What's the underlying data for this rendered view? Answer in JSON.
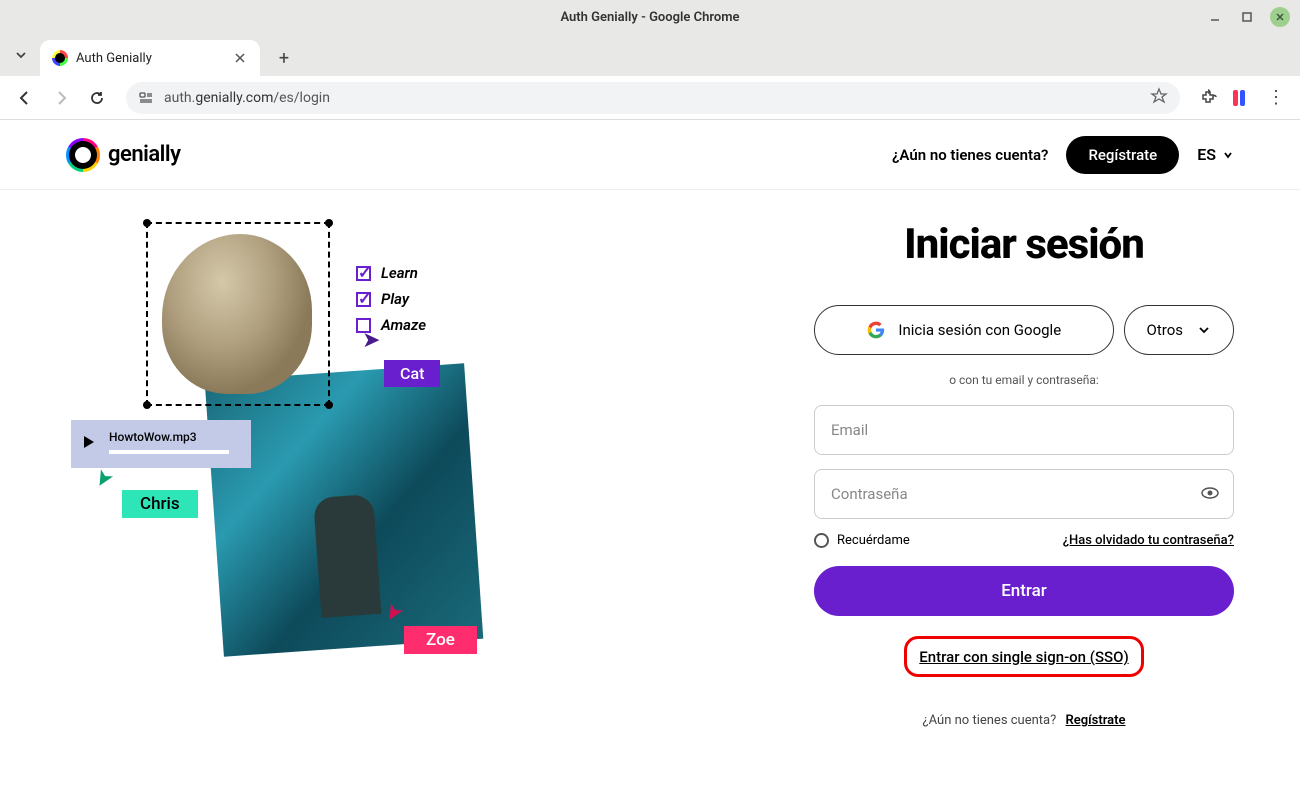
{
  "window": {
    "title": "Auth Genially - Google Chrome"
  },
  "tab": {
    "title": "Auth Genially"
  },
  "url": {
    "prefix": "auth.",
    "domain": "genially.com",
    "path": "/es/login"
  },
  "header": {
    "noaccount": "¿Aún no tienes cuenta?",
    "register": "Regístrate",
    "lang": "ES",
    "brand": "genially"
  },
  "illustration": {
    "todo": {
      "learn": "Learn",
      "play": "Play",
      "amaze": "Amaze"
    },
    "cat_tag": "Cat",
    "audio": "HowtoWow.mp3",
    "chris": "Chris",
    "zoe": "Zoe"
  },
  "form": {
    "title": "Iniciar sesión",
    "google": "Inicia sesión con Google",
    "others": "Otros",
    "divider": "o con tu email y contraseña:",
    "email_ph": "Email",
    "password_ph": "Contraseña",
    "remember": "Recuérdame",
    "forgot": "¿Has olvidado tu contraseña?",
    "enter": "Entrar",
    "sso": "Entrar con single sign-on (SSO)",
    "footer_q": "¿Aún no tienes cuenta?",
    "footer_link": "Regístrate"
  }
}
